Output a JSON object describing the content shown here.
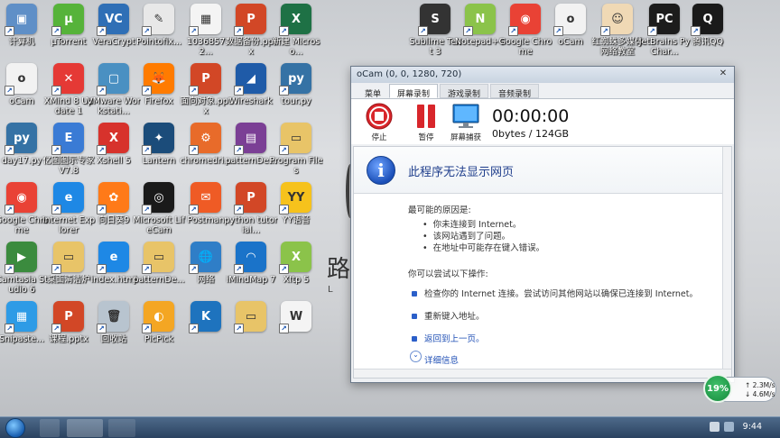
{
  "desktop_icons": [
    {
      "label": "计算机",
      "color": "#5f8fc7",
      "glyph": "▣"
    },
    {
      "label": "µTorrent",
      "color": "#56b33a",
      "glyph": "µ"
    },
    {
      "label": "VeraCrypt",
      "color": "#2f6fb6",
      "glyph": "VC"
    },
    {
      "label": "Pointofix...",
      "color": "#e8e8e8",
      "glyph": "✎"
    },
    {
      "label": "1036857 2...",
      "color": "#f4f4f4",
      "glyph": "▦"
    },
    {
      "label": "数据备份.pptx",
      "color": "#d24726",
      "glyph": "P"
    },
    {
      "label": "新建 Microso...",
      "color": "#1e7145",
      "glyph": "X"
    },
    {
      "label": "Sublime Text 3",
      "color": "#333333",
      "glyph": "S"
    },
    {
      "label": "Notepad++",
      "color": "#8bc34a",
      "glyph": "N"
    },
    {
      "label": "Google Chrome",
      "color": "#e94235",
      "glyph": "◉"
    },
    {
      "label": "oCam",
      "color": "#f2f2f2",
      "glyph": "o"
    },
    {
      "label": "红蜘蛛多媒体网络教室",
      "color": "#f0d9b5",
      "glyph": "☺"
    },
    {
      "label": "JetBrains PyChar...",
      "color": "#1c1c1c",
      "glyph": "PC"
    },
    {
      "label": "腾讯QQ",
      "color": "#1a1a1a",
      "glyph": "Q"
    },
    {
      "label": "oCam",
      "color": "#f2f2f2",
      "glyph": "o"
    },
    {
      "label": "XMind 8 Update 1",
      "color": "#e53935",
      "glyph": "✕"
    },
    {
      "label": "VMware Workstati...",
      "color": "#4a90c2",
      "glyph": "▢"
    },
    {
      "label": "Firefox",
      "color": "#ff7b00",
      "glyph": "🦊"
    },
    {
      "label": "面向对象.pptx",
      "color": "#d24726",
      "glyph": "P"
    },
    {
      "label": "Wireshark",
      "color": "#1f5ba8",
      "glyph": "◢"
    },
    {
      "label": "tour.py",
      "color": "#3572a5",
      "glyph": "py"
    },
    {
      "label": "day17.py",
      "color": "#3572a5",
      "glyph": "py"
    },
    {
      "label": "亿图图示专家V7.8",
      "color": "#3a7bd5",
      "glyph": "E"
    },
    {
      "label": "Xshell 5",
      "color": "#d7322c",
      "glyph": "X"
    },
    {
      "label": "Lantern",
      "color": "#1b4c7a",
      "glyph": "✦"
    },
    {
      "label": "chromedri...",
      "color": "#e86b2a",
      "glyph": "⚙"
    },
    {
      "label": "patternDe...",
      "color": "#7b3f95",
      "glyph": "▤"
    },
    {
      "label": "Program Files",
      "color": "#e8c468",
      "glyph": "▭"
    },
    {
      "label": "Google Chrome",
      "color": "#e94235",
      "glyph": "◉"
    },
    {
      "label": "Internet Explorer",
      "color": "#1e88e5",
      "glyph": "e"
    },
    {
      "label": "向日葵9",
      "color": "#ff7a18",
      "glyph": "✿"
    },
    {
      "label": "Microsoft LifeCam",
      "color": "#1a1a1a",
      "glyph": "◎"
    },
    {
      "label": "Postman",
      "color": "#ef5b25",
      "glyph": "✉"
    },
    {
      "label": "python tutorial...",
      "color": "#d24726",
      "glyph": "P"
    },
    {
      "label": "YY语音",
      "color": "#f6c21c",
      "glyph": "YY"
    },
    {
      "label": "Camtasia Studio 6",
      "color": "#3b8b3e",
      "glyph": "▶"
    },
    {
      "label": "桌面清洁炉",
      "color": "#e8c468",
      "glyph": "▭"
    },
    {
      "label": "index.html",
      "color": "#1e88e5",
      "glyph": "e"
    },
    {
      "label": "patternDe...",
      "color": "#e8c468",
      "glyph": "▭"
    },
    {
      "label": "网络",
      "color": "#2f7ec7",
      "glyph": "🌐"
    },
    {
      "label": "iMindMap 7",
      "color": "#1a73c9",
      "glyph": "◠"
    },
    {
      "label": "Xftp 5",
      "color": "#8bc34a",
      "glyph": "X"
    },
    {
      "label": "Snipaste...",
      "color": "#2e9be6",
      "glyph": "▦"
    },
    {
      "label": "课程.pptx",
      "color": "#d24726",
      "glyph": "P"
    },
    {
      "label": "回收站",
      "color": "#b8c4cf",
      "glyph": "🗑"
    },
    {
      "label": "PicPick",
      "color": "#f4a623",
      "glyph": "◐"
    },
    {
      "label": "",
      "color": "#1e73be",
      "glyph": "K"
    },
    {
      "label": "",
      "color": "#e8c468",
      "glyph": "▭"
    },
    {
      "label": "",
      "color": "#f4f4f4",
      "glyph": "W"
    }
  ],
  "background": {
    "char": "路",
    "sub": "L"
  },
  "ocam": {
    "title": "oCam (0, 0, 1280, 720)",
    "close": "✕",
    "tabs": [
      {
        "label": "菜单",
        "state": "plain"
      },
      {
        "label": "屏幕录制",
        "state": "active"
      },
      {
        "label": "游戏录制",
        "state": "inactive"
      },
      {
        "label": "音频录制",
        "state": "inactive"
      }
    ],
    "tools": [
      {
        "label": "停止",
        "icon": "stop-icon"
      },
      {
        "label": "暂停",
        "icon": "pause-icon"
      },
      {
        "label": "屏幕捕获",
        "icon": "monitor-icon"
      }
    ],
    "timer": "00:00:00",
    "size": "0bytes / 124GB"
  },
  "error_page": {
    "title": "此程序无法显示网页",
    "reasons_heading": "最可能的原因是:",
    "reasons": [
      "你未连接到 Internet。",
      "该网站遇到了问题。",
      "在地址中可能存在键入错误。"
    ],
    "actions_heading": "你可以尝试以下操作:",
    "actions": [
      {
        "label": "检查你的 Internet 连接。尝试访问其他网站以确保已连接到 Internet。",
        "link": false
      },
      {
        "label": "重新键入地址。",
        "link": false
      },
      {
        "label": "返回到上一页。",
        "link": true
      }
    ],
    "details": "详细信息"
  },
  "net_widget": {
    "percent": "19%",
    "up": "2.3M/s",
    "down": "4.6M/s"
  },
  "taskbar": {
    "clock": "9:44"
  },
  "colors": {
    "accent": "#1f4fb5",
    "stop": "#d8262b",
    "pause": "#d8262b"
  }
}
